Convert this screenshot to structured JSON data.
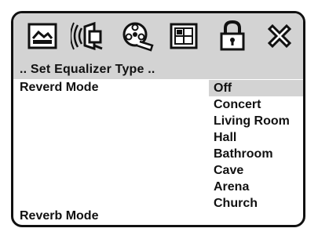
{
  "toolbar": {
    "icons": [
      "screen-icon",
      "speaker-icon",
      "film-reel-icon",
      "grid-icon",
      "lock-icon",
      "close-icon"
    ]
  },
  "menu": {
    "header": ".. Set Equalizer Type ..",
    "row_label": "Reverd Mode",
    "footer_label": "Reverb Mode",
    "options": [
      "Off",
      "Concert",
      "Living Room",
      "Hall",
      "Bathroom",
      "Cave",
      "Arena",
      "Church"
    ],
    "selected": "Off"
  },
  "colors": {
    "highlight": "#d3d3d3",
    "border": "#111111"
  }
}
